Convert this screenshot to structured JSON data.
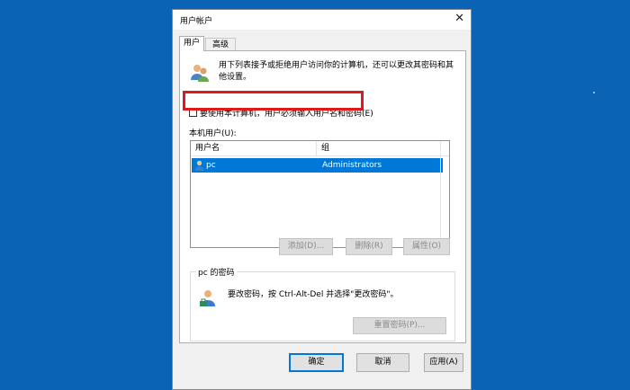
{
  "dialog": {
    "title": "用户帐户",
    "tabs": [
      "用户",
      "高级"
    ],
    "intro": "用下列表接予或拒绝用户访问你的计算机，还可以更改其密码和其他设置。",
    "require_password_label": "要使用本计算机，用户必须输入用户名和密码(E)",
    "require_password_checked": false,
    "local_users_label": "本机用户(U):",
    "users_table": {
      "columns": [
        "用户名",
        "组"
      ],
      "rows": [
        {
          "name": "pc",
          "group": "Administrators",
          "selected": true
        }
      ]
    },
    "buttons": {
      "add": "添加(D)...",
      "remove": "删除(R)",
      "properties": "属性(O)"
    },
    "password_group": {
      "title": "pc 的密码",
      "text": "要改密码，按 Ctrl-Alt-Del 并选择\"更改密码\"。",
      "reset_button": "重置密码(P)..."
    },
    "footer": {
      "ok": "确定",
      "cancel": "取消",
      "apply": "应用(A)"
    }
  },
  "colors": {
    "desktop": "#0b63b6",
    "selection": "#0078d7",
    "highlight_box": "#e01a1a"
  },
  "icons": [
    "close-icon",
    "users-icon",
    "user-row-icon",
    "key-user-icon"
  ]
}
